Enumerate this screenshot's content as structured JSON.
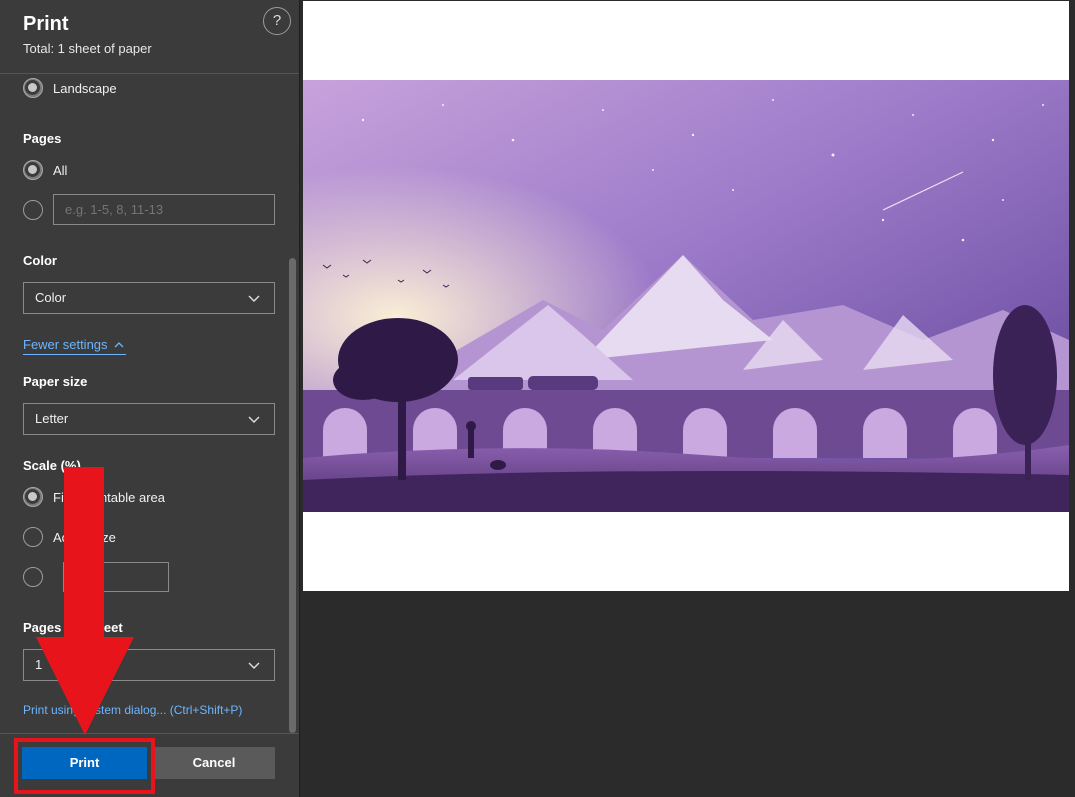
{
  "header": {
    "title": "Print",
    "subtitle": "Total: 1 sheet of paper",
    "help_label": "?"
  },
  "layout_section": {
    "landscape_label": "Landscape"
  },
  "pages_section": {
    "label": "Pages",
    "all_label": "All",
    "range_placeholder": "e.g. 1-5, 8, 11-13"
  },
  "color_section": {
    "label": "Color",
    "selected": "Color"
  },
  "fewer_settings_label": "Fewer settings",
  "paper_size_section": {
    "label": "Paper size",
    "selected": "Letter"
  },
  "scale_section": {
    "label": "Scale (%)",
    "fit_label": "Fit to printable area",
    "actual_label": "Actual size",
    "custom_value": ""
  },
  "pages_per_sheet_section": {
    "label": "Pages per sheet",
    "selected": "1"
  },
  "system_dialog_link": "Print using system dialog... (Ctrl+Shift+P)",
  "buttons": {
    "print": "Print",
    "cancel": "Cancel"
  },
  "colors": {
    "primary_button": "#0067c0",
    "highlight": "#e8141b",
    "link": "#6cb6ff"
  }
}
